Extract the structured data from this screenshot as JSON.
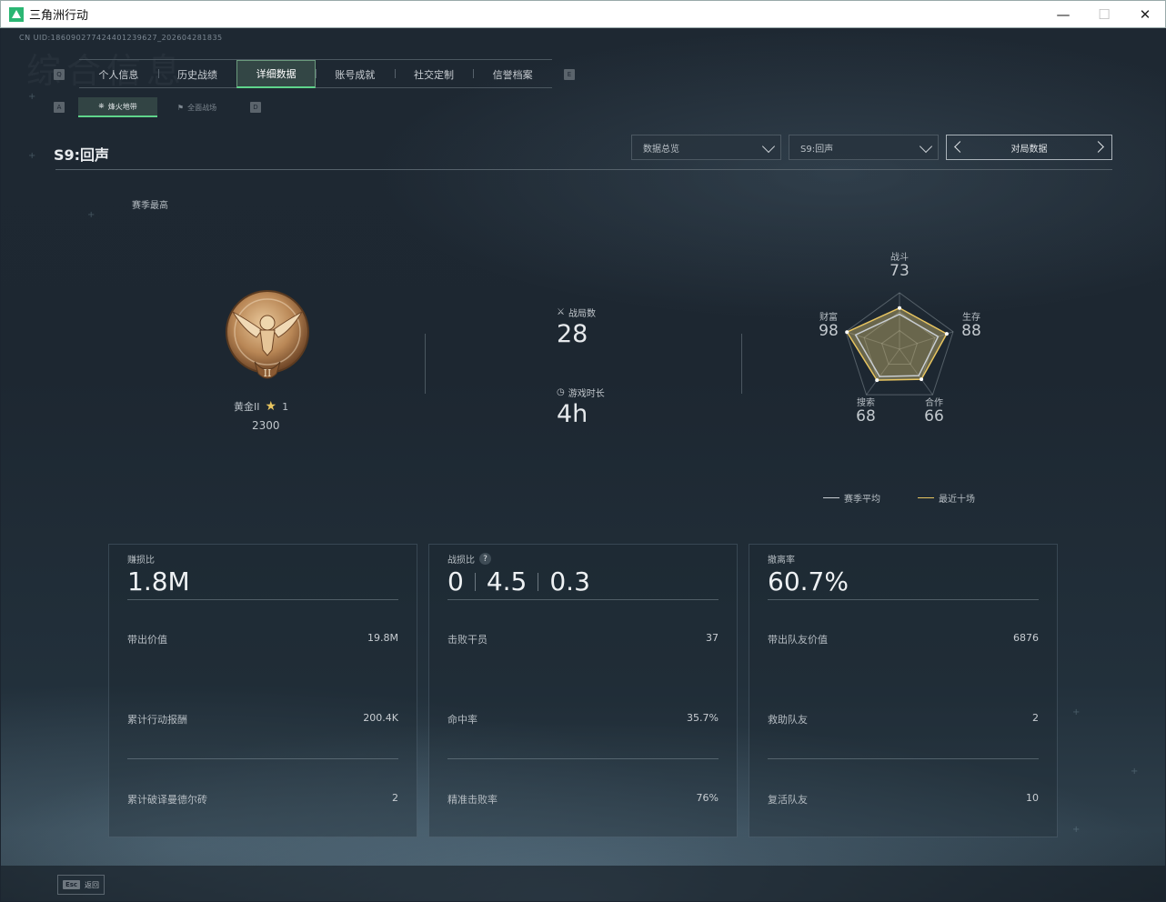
{
  "window": {
    "title": "三角洲行动",
    "minimize": "—",
    "maximize": "☐",
    "close": "✕"
  },
  "uid": "CN UID:18609027742440123962​7_202604281835",
  "ghost_title": "综合信息",
  "tabs": [
    "个人信息",
    "历史战绩",
    "详细数据",
    "账号成就",
    "社交定制",
    "信誉档案"
  ],
  "tab_keys": {
    "left": "Q",
    "right": "E"
  },
  "subtabs": [
    "烽火地带",
    "全面战场"
  ],
  "subtab_keys": {
    "left": "A",
    "right": "D"
  },
  "season": "S9:回声",
  "dropdowns": {
    "mode": "数据总览",
    "season": "S9:回声"
  },
  "pager": {
    "label": "对局数据"
  },
  "best_label": "赛季最高",
  "rank": {
    "name": "黄金II",
    "stars": "1",
    "score": "2300",
    "medal_roman": "II"
  },
  "games": {
    "label": "战局数",
    "value": "28"
  },
  "playtime": {
    "label": "游戏时长",
    "value": "4h"
  },
  "radar": {
    "axes": [
      {
        "name": "战斗",
        "value": "73"
      },
      {
        "name": "生存",
        "value": "88"
      },
      {
        "name": "合作",
        "value": "66"
      },
      {
        "name": "搜索",
        "value": "68"
      },
      {
        "name": "财富",
        "value": "98"
      }
    ],
    "season_avg": [
      0.62,
      0.72,
      0.58,
      0.6,
      0.82
    ],
    "recent_ten": [
      0.73,
      0.88,
      0.66,
      0.68,
      0.98
    ],
    "colors": {
      "season_avg": "#c8cdd2",
      "recent_ten": "#e8c560"
    }
  },
  "legend": {
    "season_avg": "赛季平均",
    "recent_ten": "最近十场"
  },
  "cards": [
    {
      "title": "赚损比",
      "big": [
        "1.8M"
      ],
      "rows": [
        {
          "label": "带出价值",
          "value": "19.8M"
        },
        {
          "label": "累计行动报酬",
          "value": "200.4K"
        },
        {
          "label": "累计破译曼德尔砖",
          "value": "2"
        }
      ]
    },
    {
      "title": "战损比",
      "help": "?",
      "big": [
        "0",
        "4.5",
        "0.3"
      ],
      "rows": [
        {
          "label": "击败干员",
          "value": "37"
        },
        {
          "label": "命中率",
          "value": "35.7%"
        },
        {
          "label": "精准击败率",
          "value": "76%"
        }
      ]
    },
    {
      "title": "撤离率",
      "big": [
        "60.7%"
      ],
      "rows": [
        {
          "label": "带出队友价值",
          "value": "6876"
        },
        {
          "label": "救助队友",
          "value": "2"
        },
        {
          "label": "复活队友",
          "value": "10"
        }
      ]
    }
  ],
  "esc": {
    "key": "Esc",
    "label": "返回"
  }
}
